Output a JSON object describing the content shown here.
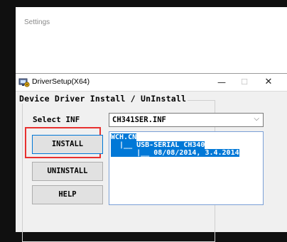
{
  "background_window": {
    "title": "Settings"
  },
  "dialog": {
    "title": "DriverSetup(X64)",
    "controls": {
      "minimize": "—",
      "maximize": "☐",
      "close": "✕"
    },
    "group_title": "Device Driver Install / UnInstall",
    "select_inf": {
      "label": "Select INF",
      "value": "CH341SER.INF",
      "arrow": "⌵"
    },
    "buttons": {
      "install": "INSTALL",
      "uninstall": "UNINSTALL",
      "help": "HELP"
    },
    "info_lines": [
      "WCH.CN",
      "  |__ USB-SERIAL CH340",
      "      |__ 08/08/2014, 3.4.2014"
    ]
  },
  "colors": {
    "selection": "#0078d7",
    "highlight_box": "#e8302f"
  }
}
